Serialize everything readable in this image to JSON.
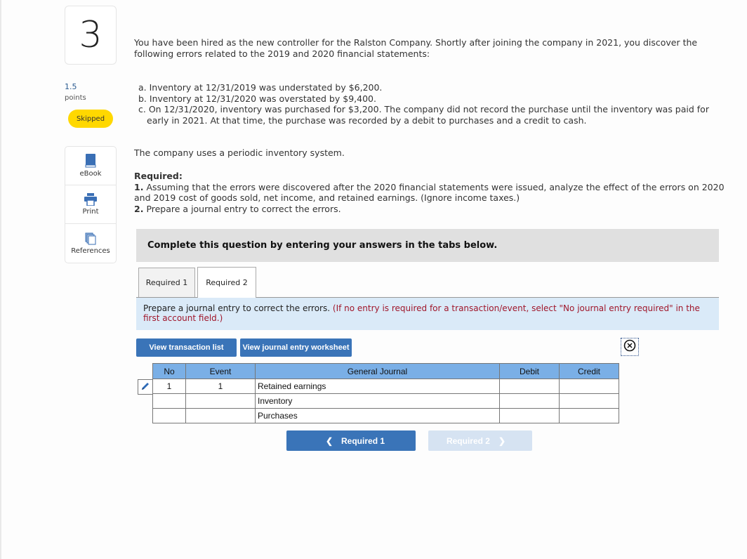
{
  "question": {
    "number": "3",
    "points_value": "1.5",
    "points_label": "points",
    "status": "Skipped"
  },
  "tools": [
    {
      "label": "eBook",
      "icon": "book-icon"
    },
    {
      "label": "Print",
      "icon": "printer-icon"
    },
    {
      "label": "References",
      "icon": "references-icon"
    }
  ],
  "content": {
    "intro": "You have been hired as the new controller for the Ralston Company. Shortly after joining the company in 2021, you discover the following errors related to the 2019 and 2020 financial statements:",
    "errors": [
      "a. Inventory at 12/31/2019 was understated by $6,200.",
      "b. Inventory at 12/31/2020 was overstated by $9,400.",
      "c. On 12/31/2020, inventory was purchased for $3,200. The company did not record the purchase until the inventory was paid for",
      "early in 2021. At that time, the purchase was recorded by a debit to purchases and a credit to cash."
    ],
    "periodic": "The company uses a periodic inventory system.",
    "required_heading": "Required:",
    "required_items": [
      {
        "num": "1.",
        "text": "Assuming that the errors were discovered after the 2020 financial statements were issued, analyze the effect of the errors on 2020 and 2019 cost of goods sold, net income, and retained earnings. (Ignore income taxes.)"
      },
      {
        "num": "2.",
        "text": "Prepare a journal entry to correct the errors."
      }
    ]
  },
  "banner": "Complete this question by entering your answers in the tabs below.",
  "tabs": [
    {
      "label": "Required 1",
      "active": false
    },
    {
      "label": "Required 2",
      "active": true
    }
  ],
  "instruction": {
    "main": "Prepare a journal entry to correct the errors.",
    "note": "(If no entry is required for a transaction/event, select \"No journal entry required\" in the first account field.)"
  },
  "buttons": {
    "view_transaction_list": "View transaction list",
    "view_journal_worksheet": "View journal entry worksheet",
    "prev": "Required 1",
    "next": "Required 2"
  },
  "journal": {
    "headers": [
      "No",
      "Event",
      "General Journal",
      "Debit",
      "Credit"
    ],
    "rows": [
      {
        "no": "1",
        "event": "1",
        "account": "Retained earnings",
        "debit": "",
        "credit": ""
      },
      {
        "no": "",
        "event": "",
        "account": "Inventory",
        "debit": "",
        "credit": ""
      },
      {
        "no": "",
        "event": "",
        "account": "Purchases",
        "debit": "",
        "credit": ""
      }
    ]
  },
  "colors": {
    "accent_blue": "#3a74b8",
    "table_header": "#7aafe6",
    "status_yellow": "#ffd800",
    "note_red": "#a0172b"
  }
}
